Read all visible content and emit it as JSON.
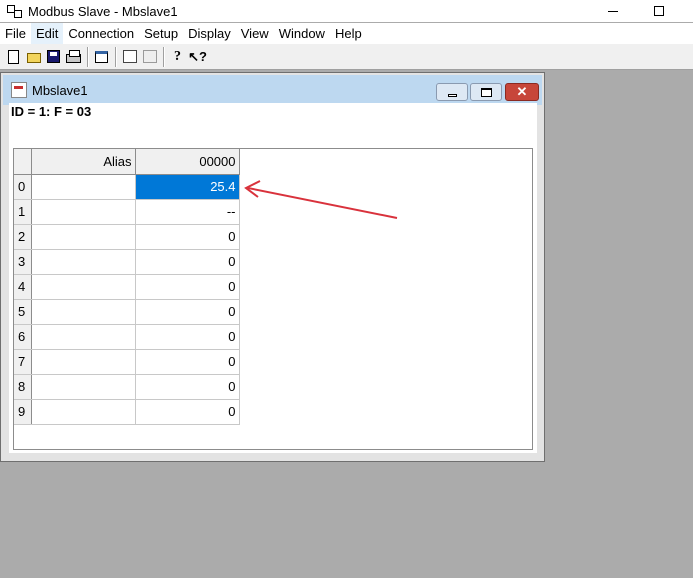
{
  "titlebar": {
    "title": "Modbus Slave - Mbslave1",
    "icon": "modbus-app-icon"
  },
  "menubar": {
    "items": [
      "File",
      "Edit",
      "Connection",
      "Setup",
      "Display",
      "View",
      "Window",
      "Help"
    ],
    "highlighted": "Edit"
  },
  "toolbar": {
    "icons": [
      "new-icon",
      "open-icon",
      "save-icon",
      "print-icon",
      "window-icon",
      "connect-icon",
      "disconnect-icon",
      "help-icon",
      "whats-this-icon"
    ]
  },
  "child_window": {
    "title": "Mbslave1",
    "status": "ID = 1: F = 03",
    "grid": {
      "headers": [
        "Alias",
        "00000"
      ],
      "rows": [
        {
          "index": "0",
          "alias": "",
          "value": "25.4",
          "selected": true
        },
        {
          "index": "1",
          "alias": "",
          "value": "--"
        },
        {
          "index": "2",
          "alias": "",
          "value": "0"
        },
        {
          "index": "3",
          "alias": "",
          "value": "0"
        },
        {
          "index": "4",
          "alias": "",
          "value": "0"
        },
        {
          "index": "5",
          "alias": "",
          "value": "0"
        },
        {
          "index": "6",
          "alias": "",
          "value": "0"
        },
        {
          "index": "7",
          "alias": "",
          "value": "0"
        },
        {
          "index": "8",
          "alias": "",
          "value": "0"
        },
        {
          "index": "9",
          "alias": "",
          "value": "0"
        }
      ]
    }
  },
  "colors": {
    "desktop": "#ababab",
    "selection": "#0078d7",
    "annotation_arrow": "#d9323c",
    "close_button": "#c7463a"
  }
}
